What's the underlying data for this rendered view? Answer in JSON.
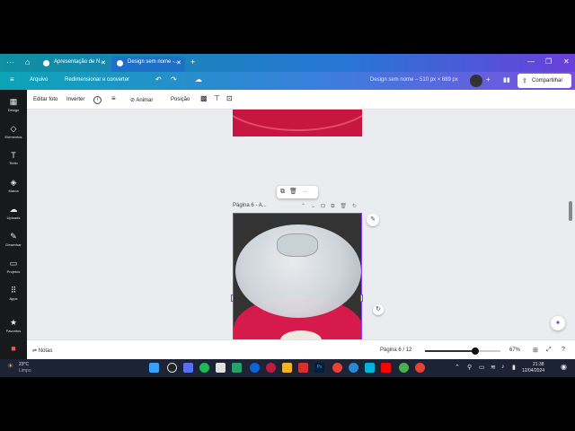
{
  "browser": {
    "tabs": [
      {
        "title": "Apresentação de N...",
        "active": false
      },
      {
        "title": "Design sem nome -...",
        "active": true
      }
    ],
    "new_tab": "+",
    "window_controls": [
      "—",
      "❐",
      "✕"
    ]
  },
  "header": {
    "menu_icon": "hamburger-icon",
    "file": "Arquivo",
    "resize": "Redimensionar e converter",
    "title": "Design sem nome – 510 px × 689 px",
    "share": "Compartilhar",
    "add": "+"
  },
  "sidebar": {
    "items": [
      {
        "label": "Design",
        "icon": "▦"
      },
      {
        "label": "Elementos",
        "icon": "◇"
      },
      {
        "label": "Texto",
        "icon": "T"
      },
      {
        "label": "Marca",
        "icon": "◈"
      },
      {
        "label": "Uploads",
        "icon": "☁"
      },
      {
        "label": "Desenhar",
        "icon": "✎"
      },
      {
        "label": "Projetos",
        "icon": "▭"
      },
      {
        "label": "Apps",
        "icon": "⠿"
      },
      {
        "label": "Favoritos",
        "icon": "★"
      }
    ]
  },
  "toolbar": {
    "edit_photo": "Editar foto",
    "flip": "Inverter",
    "info": "i",
    "animate": "Animar",
    "position": "Posição"
  },
  "canvas": {
    "page_label": "Página 6 - A...",
    "context_tools": "⧉ 🗑 ⋯"
  },
  "footer": {
    "notes": "Notas",
    "page_indicator": "Página 6 / 12",
    "zoom": "67%",
    "zoom_level": 0.67
  },
  "taskbar": {
    "weather_temp": "23°C",
    "weather_desc": "Limpo",
    "time": "21:38",
    "date": "12/04/2024"
  }
}
